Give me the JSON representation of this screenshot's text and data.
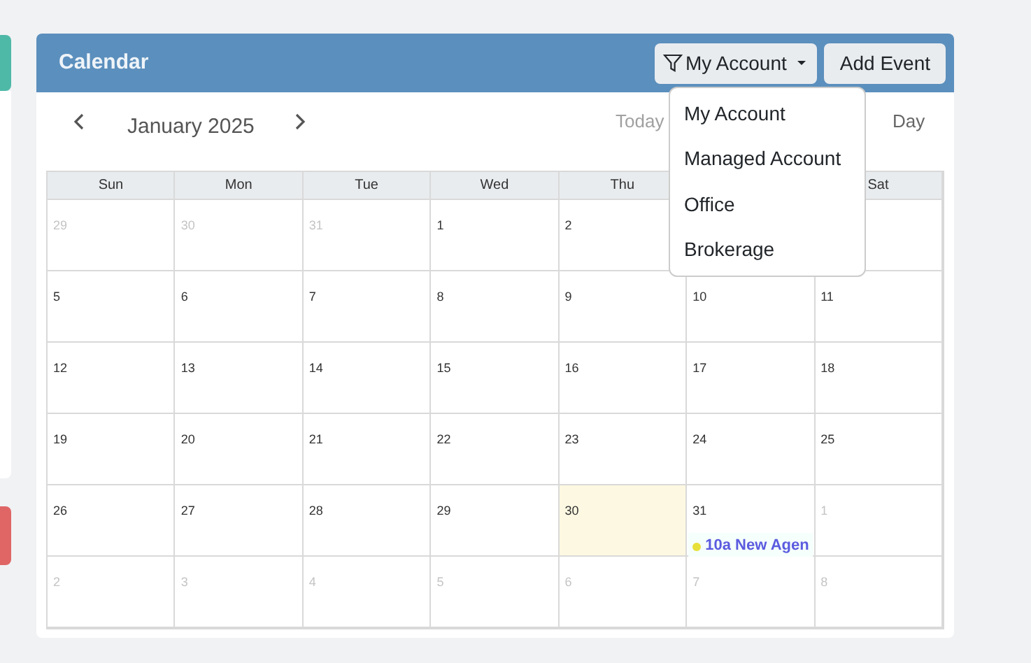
{
  "title": "Calendar",
  "filter_button": {
    "label": "My Account"
  },
  "add_button": {
    "label": "Add Event"
  },
  "filter_menu": [
    {
      "label": "My Account"
    },
    {
      "label": "Managed Account"
    },
    {
      "label": "Office"
    },
    {
      "label": "Brokerage"
    }
  ],
  "month": "January 2025",
  "view_buttons": [
    {
      "label": "Today",
      "disabled": true
    },
    {
      "label": "Day",
      "disabled": false
    }
  ],
  "weekdays": [
    "Sun",
    "Mon",
    "Tue",
    "Wed",
    "Thu"
  ],
  "weekdays_right": [
    "Sat"
  ],
  "weeks": [
    [
      {
        "day": "29",
        "outside": true
      },
      {
        "day": "30",
        "outside": true
      },
      {
        "day": "31",
        "outside": true
      },
      {
        "day": "1",
        "outside": false
      },
      {
        "day": "2",
        "outside": false
      }
    ],
    [
      {
        "day": "5",
        "outside": false
      },
      {
        "day": "6",
        "outside": false
      },
      {
        "day": "7",
        "outside": false
      },
      {
        "day": "8",
        "outside": false
      },
      {
        "day": "9",
        "outside": false
      },
      {
        "day": "10",
        "outside": false
      },
      {
        "day": "11",
        "outside": false
      }
    ],
    [
      {
        "day": "12",
        "outside": false
      },
      {
        "day": "13",
        "outside": false
      },
      {
        "day": "14",
        "outside": false
      },
      {
        "day": "15",
        "outside": false
      },
      {
        "day": "16",
        "outside": false
      },
      {
        "day": "17",
        "outside": false
      },
      {
        "day": "18",
        "outside": false
      }
    ],
    [
      {
        "day": "19",
        "outside": false
      },
      {
        "day": "20",
        "outside": false
      },
      {
        "day": "21",
        "outside": false
      },
      {
        "day": "22",
        "outside": false
      },
      {
        "day": "23",
        "outside": false
      },
      {
        "day": "24",
        "outside": false
      },
      {
        "day": "25",
        "outside": false
      }
    ],
    [
      {
        "day": "26",
        "outside": false
      },
      {
        "day": "27",
        "outside": false
      },
      {
        "day": "28",
        "outside": false
      },
      {
        "day": "29",
        "outside": false
      },
      {
        "day": "30",
        "outside": false,
        "today": true
      },
      {
        "day": "31",
        "outside": false,
        "events": [
          {
            "time": "10a",
            "title": "New Agen",
            "color": "#e8e03a"
          }
        ]
      },
      {
        "day": "1",
        "outside": true
      }
    ],
    [
      {
        "day": "2",
        "outside": true
      },
      {
        "day": "3",
        "outside": true
      },
      {
        "day": "4",
        "outside": true
      },
      {
        "day": "5",
        "outside": true
      },
      {
        "day": "6",
        "outside": true
      },
      {
        "day": "7",
        "outside": true
      },
      {
        "day": "8",
        "outside": true
      }
    ]
  ]
}
